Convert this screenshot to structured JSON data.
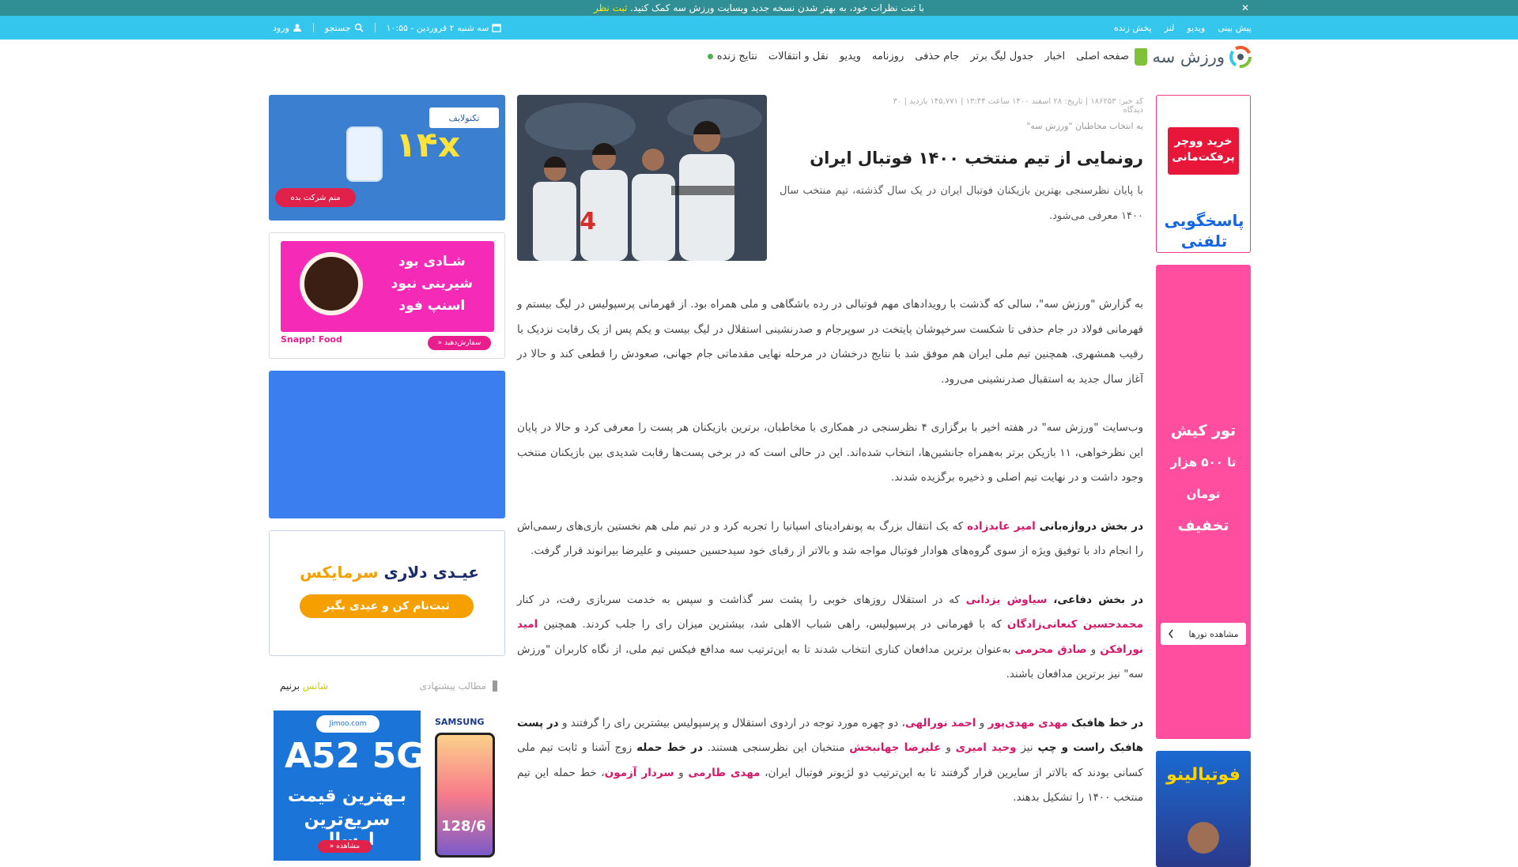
{
  "notice": {
    "text": "با ثبت نظرات خود، به بهتر شدن نسخه جدید وبسایت ورزش سه کمک کنید.",
    "link": "ثبت نظر",
    "close": "✕"
  },
  "topbar": {
    "links": [
      "پیش بینی",
      "ویدیو",
      "لنز",
      "پخش زنده"
    ],
    "date": "سه شنبه ۲ فروردین - ۱۰:۵۵",
    "search": "جستجو",
    "login": "ورود"
  },
  "nav": {
    "logo_text": "ورزش سه",
    "items": [
      "صفحه اصلی",
      "اخبار",
      "جدول لیگ برتر",
      "جام حذفی",
      "روزنامه",
      "ویدیو",
      "نقل و انتقالات",
      "نتایج زنده"
    ]
  },
  "article": {
    "meta": "کد خبر: ۱۸۶۲۵۳ | تاریخ: ۲۸ اسفند ۱۴۰۰ ساعت ۱۳:۴۴ | ۱۴۵,۷۷۱ بازدید | ۳۰ دیدگاه",
    "source": "به انتخاب مخاطبان \"ورزش سه\"",
    "title": "رونمایی از تیم منتخب ۱۴۰۰ فوتبال ایران",
    "lead": "با پایان نظرسنجی بهترین بازیکنان فوتبال ایران در یک سال گذشته، تیم منتخب سال ۱۴۰۰ معرفی می‌شود.",
    "p1": "به گزارش \"ورزش سه\"، سالی که گذشت با رویدادهای مهم فوتبالی در رده باشگاهی و ملی همراه بود. از قهرمانی پرسپولیس در لیگ بیستم و قهرمانی فولاد در جام حذفی تا شکست سرخپوشان پایتخت در سوپرجام و صدرنشینی استقلال در لیگ بیست و یکم پس از یک رقابت نزدیک با رقیب همشهری. همچنین تیم ملی ایران هم موفق شد با نتایج درخشان در مرحله نهایی مقدماتی جام جهانی، صعودش را قطعی کند و حالا در آغاز سال جدید به استقبال صدرنشینی می‌رود.",
    "p2": "وب‌سایت \"ورزش سه\" در هفته اخیر با برگزاری ۴ نظرسنجی در همکاری با مخاطبان، برترین بازیکنان هر پست را معرفی کرد و حالا در پایان این نظرخواهی، ۱۱ بازیکن برتر به‌همراه جانشین‌ها، انتخاب شده‌اند. این در حالی است که در برخی پست‌ها رقابت شدیدی بین بازیکنان منتخب وجود داشت و در نهایت تیم اصلی و ذخیره برگزیده شدند.",
    "p3_lead": "در بخش دروازه‌بانی",
    "p3_name1": "امیر عابدزاده",
    "p3_rest": "که یک انتقال بزرگ به پونفرادینای اسپانیا را تجربه کرد و در تیم ملی هم نخستین بازی‌های رسمی‌اش را انجام داد با توفیق ویژه از سوی گروه‌های هوادار فوتبال مواجه شد و بالاتر از رقبای خود سیدحسین حسینی و علیرضا بیرانوند قرار گرفت.",
    "p4_lead": "در بخش دفاعی،",
    "p4_name1": "سیاوش یزدانی",
    "p4_t1": "که در استقلال روزهای خوبی را پشت سر گذاشت و سپس به خدمت سربازی رفت، در کنار",
    "p4_name2": "محمدحسین کنعانی‌زادگان",
    "p4_t2": "که با قهرمانی در پرسپولیس، راهی شباب الاهلی شد، بیشترین میزان رای را جلب کردند. همچنین",
    "p4_name3": "امید نورافکن",
    "p4_t3": "و",
    "p4_name4": "صادق محرمی",
    "p4_t4": "به‌عنوان برترین مدافعان کناری انتخاب شدند تا به این‌ترتیب سه مدافع فیکس تیم ملی، از نگاه کاربران \"ورزش سه\" نیز برترین مدافعان باشند.",
    "p5_lead": "در خط هافبک",
    "p5_name1": "مهدی مهدی‌پور",
    "p5_t1": "و",
    "p5_name2": "احمد نورالهی",
    "p5_t2": "، دو چهره مورد توجه در اردوی استقلال و پرسپولیس بیشترین رای را گرفتند و",
    "p5_lead2": "در پست هافبک راست و چپ",
    "p5_t3": "نیز",
    "p5_name3": "وحید امیری",
    "p5_t4": "و",
    "p5_name4": "علیرضا جهانبخش",
    "p5_t5": "منتخبان این نظرسنجی هستند.",
    "p5_lead3": "در خط حمله",
    "p5_t6": "زوج آشنا و ثابت تیم ملی کسانی بودند که بالاتر از سایرین قرار گرفتند تا به این‌ترتیب دو لژیونر فوتبال ایران،",
    "p5_name5": "مهدی طارمی",
    "p5_t7": "و",
    "p5_name6": "سردار آزمون",
    "p5_t8": "، خط حمله این تیم منتخب ۱۴۰۰ را تشکیل بدهند."
  },
  "ads_left": {
    "ad1_brand": "تکنولایف",
    "ad1_big": "۱۴x",
    "ad1_btn": "منم شرکت بده",
    "ad2_lines": [
      "شـادی بود",
      "شیرینی نبود",
      "اسنپ فود"
    ],
    "ad2_brand": "Snapp! Food",
    "ad2_btn": "سفارش‌دهید «",
    "ad4_l1a": "عیـدی دلاری",
    "ad4_l1b": "سرمایکس",
    "ad4_btn": "ثبت‌نام کن و عیدی بگیر",
    "suggest_label": "مطالب پیشنهادی",
    "suggest_brand_a": "شانس",
    "suggest_brand_b": "برنیم",
    "ad5_brand": "Jimoo.com",
    "ad5_samsung": "SAMSUNG",
    "ad5_model": "A52 5G",
    "ad5_l1": "بـهترین قیمت",
    "ad5_l2": "سریع‌ترین ارسال",
    "ad5_btn": "مشاهده «",
    "ad5_spec": "128/6"
  },
  "ads_right": {
    "rad1_top": "خرید ووچر پرفکت‌مانی",
    "rad1_bottom": "پاسخگویی تلفنی",
    "rad2_l1": "تور کیش",
    "rad2_l2": "تا ۵۰۰ هزار تومان",
    "rad2_l3": "تخفیف",
    "rad2_btn": "مشاهده تورها",
    "rad3_text": "فوتبالینو"
  },
  "colors": {
    "notice": "#2f8f95",
    "topbar": "#35c6ee",
    "highlight": "#d6186a",
    "ad_pink": "#ff4ea0"
  }
}
